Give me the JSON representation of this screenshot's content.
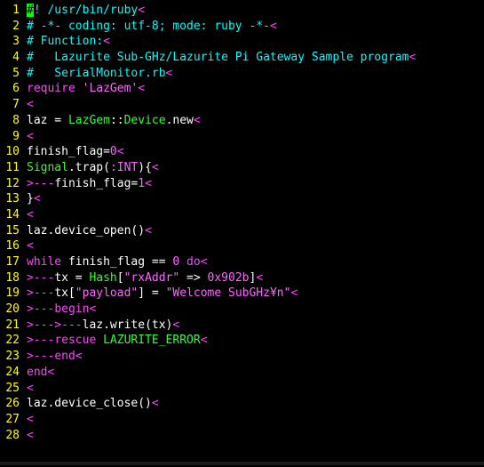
{
  "colors": {
    "background": "#000000",
    "line_number": "#ffff00",
    "text": "#ffffff",
    "comment": "#00ffff",
    "keyword": "#ff44ff",
    "constant": "#33ff33",
    "string": "#ff66ff",
    "number": "#ff66ff",
    "tab_marker": "#ff44ff",
    "eol_marker": "#ff44ff",
    "cursor_bg": "#00ff00"
  },
  "editor": {
    "lines": [
      {
        "num": "1",
        "tokens": [
          {
            "t": "#",
            "c": "cursor"
          },
          {
            "t": "! /usr/bin/ruby",
            "c": "comment"
          },
          {
            "t": "<",
            "c": "eol"
          }
        ]
      },
      {
        "num": "2",
        "tokens": [
          {
            "t": "# -*- coding: utf-8; mode: ruby -*-",
            "c": "comment"
          },
          {
            "t": "<",
            "c": "eol"
          }
        ]
      },
      {
        "num": "3",
        "tokens": [
          {
            "t": "# Function:",
            "c": "comment"
          },
          {
            "t": "<",
            "c": "eol"
          }
        ]
      },
      {
        "num": "4",
        "tokens": [
          {
            "t": "#   Lazurite Sub-GHz/Lazurite Pi Gateway Sample program",
            "c": "comment"
          },
          {
            "t": "<",
            "c": "eol"
          }
        ]
      },
      {
        "num": "5",
        "tokens": [
          {
            "t": "#   SerialMonitor.rb",
            "c": "comment"
          },
          {
            "t": "<",
            "c": "eol"
          }
        ]
      },
      {
        "num": "6",
        "tokens": [
          {
            "t": "require",
            "c": "keyword"
          },
          {
            "t": " ",
            "c": "text"
          },
          {
            "t": "'LazGem'",
            "c": "string"
          },
          {
            "t": "<",
            "c": "eol"
          }
        ]
      },
      {
        "num": "7",
        "tokens": [
          {
            "t": "<",
            "c": "eol"
          }
        ]
      },
      {
        "num": "8",
        "tokens": [
          {
            "t": "laz = ",
            "c": "text"
          },
          {
            "t": "LazGem",
            "c": "constant"
          },
          {
            "t": "::",
            "c": "text"
          },
          {
            "t": "Device",
            "c": "constant"
          },
          {
            "t": ".new",
            "c": "text"
          },
          {
            "t": "<",
            "c": "eol"
          }
        ]
      },
      {
        "num": "9",
        "tokens": [
          {
            "t": "<",
            "c": "eol"
          }
        ]
      },
      {
        "num": "10",
        "tokens": [
          {
            "t": "finish_flag=",
            "c": "text"
          },
          {
            "t": "0",
            "c": "number"
          },
          {
            "t": "<",
            "c": "eol"
          }
        ]
      },
      {
        "num": "11",
        "tokens": [
          {
            "t": "Signal",
            "c": "constant"
          },
          {
            "t": ".trap(",
            "c": "text"
          },
          {
            "t": ":INT",
            "c": "string"
          },
          {
            "t": "){",
            "c": "text"
          },
          {
            "t": "<",
            "c": "eol"
          }
        ]
      },
      {
        "num": "12",
        "tokens": [
          {
            "t": ">---",
            "c": "tab"
          },
          {
            "t": "finish_flag=",
            "c": "text"
          },
          {
            "t": "1",
            "c": "number"
          },
          {
            "t": "<",
            "c": "eol"
          }
        ]
      },
      {
        "num": "13",
        "tokens": [
          {
            "t": "}",
            "c": "text"
          },
          {
            "t": "<",
            "c": "eol"
          }
        ]
      },
      {
        "num": "14",
        "tokens": [
          {
            "t": "<",
            "c": "eol"
          }
        ]
      },
      {
        "num": "15",
        "tokens": [
          {
            "t": "laz.device_open()",
            "c": "text"
          },
          {
            "t": "<",
            "c": "eol"
          }
        ]
      },
      {
        "num": "16",
        "tokens": [
          {
            "t": "<",
            "c": "eol"
          }
        ]
      },
      {
        "num": "17",
        "tokens": [
          {
            "t": "while",
            "c": "keyword"
          },
          {
            "t": " finish_flag == ",
            "c": "text"
          },
          {
            "t": "0",
            "c": "number"
          },
          {
            "t": " ",
            "c": "text"
          },
          {
            "t": "do",
            "c": "keyword"
          },
          {
            "t": "<",
            "c": "eol"
          }
        ]
      },
      {
        "num": "18",
        "tokens": [
          {
            "t": ">---",
            "c": "tab"
          },
          {
            "t": "tx = ",
            "c": "text"
          },
          {
            "t": "Hash",
            "c": "constant"
          },
          {
            "t": "[",
            "c": "text"
          },
          {
            "t": "\"rxAddr\"",
            "c": "string"
          },
          {
            "t": " => ",
            "c": "text"
          },
          {
            "t": "0x902b",
            "c": "number"
          },
          {
            "t": "]",
            "c": "text"
          },
          {
            "t": "<",
            "c": "eol"
          }
        ]
      },
      {
        "num": "19",
        "tokens": [
          {
            "t": ">---",
            "c": "tab"
          },
          {
            "t": "tx[",
            "c": "text"
          },
          {
            "t": "\"payload\"",
            "c": "string"
          },
          {
            "t": "] = ",
            "c": "text"
          },
          {
            "t": "\"Welcome SubGHz¥n\"",
            "c": "string"
          },
          {
            "t": "<",
            "c": "eol"
          }
        ]
      },
      {
        "num": "20",
        "tokens": [
          {
            "t": ">---",
            "c": "tab"
          },
          {
            "t": "begin",
            "c": "keyword"
          },
          {
            "t": "<",
            "c": "eol"
          }
        ]
      },
      {
        "num": "21",
        "tokens": [
          {
            "t": ">--->---",
            "c": "tab"
          },
          {
            "t": "laz.write(tx)",
            "c": "text"
          },
          {
            "t": "<",
            "c": "eol"
          }
        ]
      },
      {
        "num": "22",
        "tokens": [
          {
            "t": ">---",
            "c": "tab"
          },
          {
            "t": "rescue",
            "c": "keyword"
          },
          {
            "t": " ",
            "c": "text"
          },
          {
            "t": "LAZURITE_ERROR",
            "c": "constant"
          },
          {
            "t": "<",
            "c": "eol"
          }
        ]
      },
      {
        "num": "23",
        "tokens": [
          {
            "t": ">---",
            "c": "tab"
          },
          {
            "t": "end",
            "c": "keyword"
          },
          {
            "t": "<",
            "c": "eol"
          }
        ]
      },
      {
        "num": "24",
        "tokens": [
          {
            "t": "end",
            "c": "keyword"
          },
          {
            "t": "<",
            "c": "eol"
          }
        ]
      },
      {
        "num": "25",
        "tokens": [
          {
            "t": "<",
            "c": "eol"
          }
        ]
      },
      {
        "num": "26",
        "tokens": [
          {
            "t": "laz.device_close()",
            "c": "text"
          },
          {
            "t": "<",
            "c": "eol"
          }
        ]
      },
      {
        "num": "27",
        "tokens": [
          {
            "t": "<",
            "c": "eol"
          }
        ]
      },
      {
        "num": "28",
        "tokens": [
          {
            "t": "<",
            "c": "eol"
          }
        ]
      }
    ]
  }
}
